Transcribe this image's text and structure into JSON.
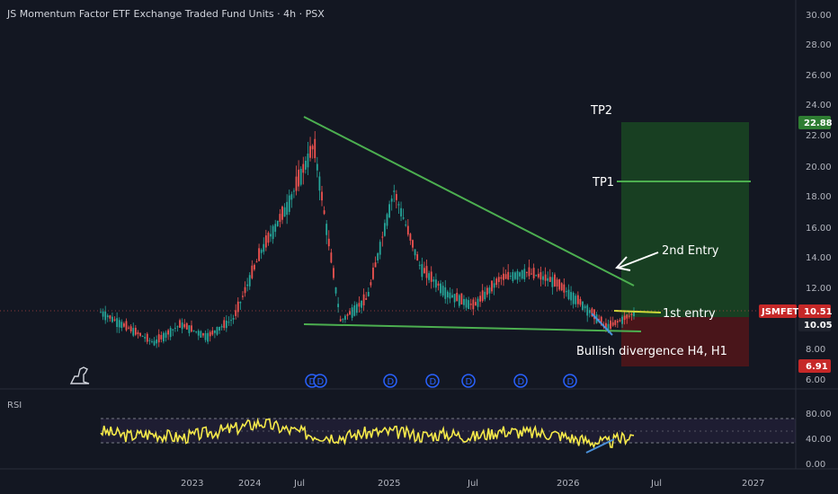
{
  "title": "JS Momentum Factor ETF Exchange Traded Fund Units · 4h · PSX",
  "symbol": "JSMFETF",
  "colors": {
    "background": "#131722",
    "candle_up": "#26a69a",
    "candle_down": "#ef5350",
    "trendline": "#4caf50",
    "rsi_line": "#f5e94a",
    "profit_zone": "#1b4d23",
    "loss_zone": "#5c1518",
    "price_badge": "#c62828",
    "target_badge": "#2e7d32",
    "divergence_line": "#4a90d9"
  },
  "price_axis": {
    "ticks": [
      "30.00",
      "28.00",
      "26.00",
      "24.00",
      "22.00",
      "20.00",
      "18.00",
      "16.00",
      "14.00",
      "12.00",
      "10.00",
      "8.00",
      "6.00"
    ],
    "badges": {
      "current": "10.51",
      "entry": "10.05",
      "target": "22.88",
      "stop": "6.91"
    }
  },
  "rsi": {
    "label": "RSI",
    "ticks": [
      "80.00",
      "40.00",
      "0.00"
    ]
  },
  "time_axis": [
    "2023",
    "2024",
    "Jul",
    "2025",
    "Jul",
    "2026",
    "Jul",
    "2027"
  ],
  "annotations": {
    "tp2": "TP2",
    "tp1": "TP1",
    "entry2": "2nd Entry",
    "entry1": "1st entry",
    "divergence": "Bullish divergence H4, H1"
  },
  "events": [
    "D",
    "D",
    "D",
    "D",
    "D",
    "D",
    "D"
  ],
  "chart_data": {
    "type": "line",
    "title": "JS Momentum Factor ETF Exchange Traded Fund Units · 4h · PSX",
    "ylim": [
      5.5,
      31
    ],
    "x": [
      "2022-11",
      "2023-01",
      "2023-04",
      "2023-07",
      "2023-10",
      "2024-01",
      "2024-03",
      "2024-05",
      "2024-07",
      "2024-09",
      "2024-11",
      "2025-01",
      "2025-03",
      "2025-05",
      "2025-07",
      "2025-09",
      "2025-11",
      "2026-01",
      "2026-02",
      "2026-03",
      "2026-04"
    ],
    "series": [
      {
        "values": [
          10.6,
          9.6,
          8.6,
          9.8,
          9.0,
          10.2,
          14.5,
          17.5,
          21.5,
          10.0,
          11.5,
          18.5,
          13.5,
          11.8,
          11.0,
          12.8,
          13.2,
          12.6,
          11.2,
          9.6,
          10.51
        ]
      }
    ],
    "rsi_series": [
      62,
      52,
      56,
      48,
      58,
      66,
      78,
      64,
      54,
      50,
      58,
      60,
      52,
      56,
      50,
      62,
      58,
      56,
      44,
      38,
      55
    ],
    "levels": {
      "tp1": 19.0,
      "tp2": 22.88,
      "entry1": 10.51,
      "entry2": 12.8,
      "stop": 6.91
    }
  }
}
